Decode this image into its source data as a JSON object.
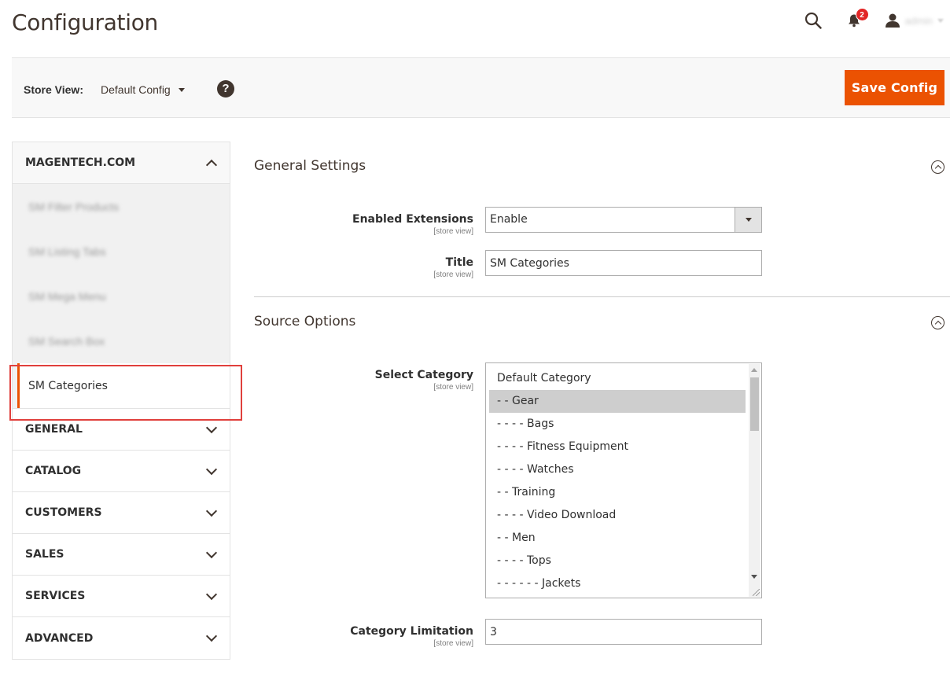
{
  "header": {
    "title": "Configuration",
    "notification_count": "2",
    "user_name": "admin"
  },
  "toolbar": {
    "store_view_label": "Store View:",
    "store_view_value": "Default Config",
    "help_symbol": "?",
    "save_label": "Save Config"
  },
  "sidebar": {
    "expanded_group": {
      "label": "MAGENTECH.COM",
      "items": [
        "SM Filter Products",
        "SM Listing Tabs",
        "SM Mega Menu",
        "SM Search Box",
        "SM Categories"
      ],
      "active_item": "SM Categories"
    },
    "groups": [
      "GENERAL",
      "CATALOG",
      "CUSTOMERS",
      "SALES",
      "SERVICES",
      "ADVANCED"
    ]
  },
  "general_settings": {
    "title": "General Settings",
    "enabled": {
      "label": "Enabled Extensions",
      "scope": "[store view]",
      "value": "Enable"
    },
    "title_field": {
      "label": "Title",
      "scope": "[store view]",
      "value": "SM Categories"
    }
  },
  "source_options": {
    "title": "Source Options",
    "select_category": {
      "label": "Select Category",
      "scope": "[store view]",
      "options": [
        "Default Category",
        "- - Gear",
        "- - - - Bags",
        "- - - - Fitness Equipment",
        "- - - - Watches",
        "- - Training",
        "- - - - Video Download",
        "- - Men",
        "- - - - Tops",
        "- - - - - - Jackets"
      ],
      "selected": "- - Gear"
    },
    "category_limitation": {
      "label": "Category Limitation",
      "scope": "[store view]",
      "value": "3"
    }
  },
  "icons": {
    "search": "search-icon",
    "notifications": "bell-icon",
    "user": "user-icon",
    "help": "help-icon",
    "collapse": "collapse-circle-icon",
    "chevron": "chevron-icon"
  },
  "colors": {
    "accent": "#eb5202",
    "badge": "#e22626",
    "highlight": "#e0403c",
    "text_dark": "#41362f"
  }
}
